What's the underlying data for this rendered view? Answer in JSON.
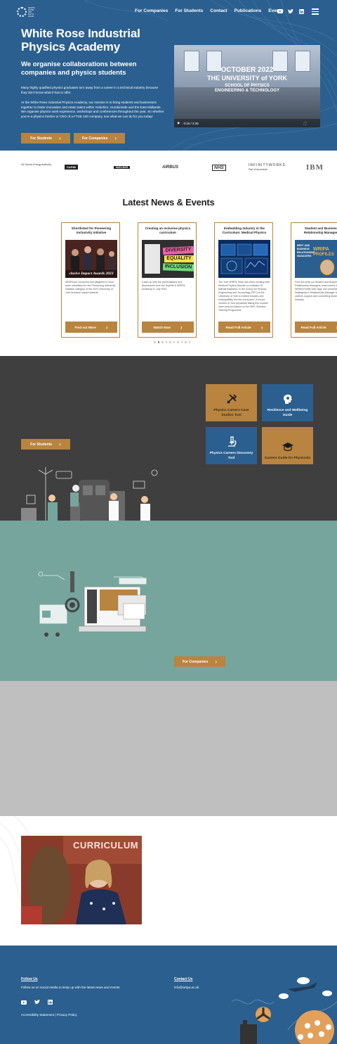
{
  "header": {
    "logo_alt": "White Rose Industrial Physics Academy",
    "nav": [
      "For Companies",
      "For Students",
      "Contact",
      "Publications",
      "Events"
    ],
    "social_icons": [
      "youtube-icon",
      "twitter-icon",
      "linkedin-icon"
    ]
  },
  "hero": {
    "title": "White Rose Industrial Physics Academy",
    "subtitle": "We organise collaborations between companies and physics students",
    "para1": "Many highly qualified physics graduates turn away from a career in a technical industry because they don't know what it has to offer.",
    "para2": "At the White Rose Industrial Physics Academy, our mission is to bring students and businesses together to foster innovation and retain talent within Yorkshire, Humberside and the East Midlands. We organise physics work experience, workshops and conferences throughout the year. So whether you're a physics fresher or CEO of a FTSE 100 company, see what we can do for you today!",
    "btn_students": "For Students",
    "btn_companies": "For Companies",
    "video": {
      "line1": "OCTOBER 2022",
      "line2": "THE UNIVERSITY of YORK",
      "line3": "SCHOOL OF PHYSICS",
      "line4": "ENGINEERING & TECHNOLOGY",
      "time": "0:15 / 2:46"
    }
  },
  "partners": [
    "UK Atomic Energy Authority",
    "CAPIM",
    "NUCLEAR",
    "AIRBUS",
    "NHS",
    "INFINITYWORKS",
    "Part of Accenture",
    "IBM"
  ],
  "news": {
    "title": "Latest News & Events",
    "cards": [
      {
        "title": "Shortlisted for Pioneering Inclusivity Initiative",
        "image_caption": "clusive Impact Awards 2023",
        "text": "WRIPA are honoured and delighted to have been shortlisted for the Pioneering Inclusivity Initiative category of the 2022 University of York Inclusive Impact Awards.",
        "button": "Find out More"
      },
      {
        "title": "Creating an inclusive physics curriculum",
        "image_words": [
          "DIVERSITY",
          "EQUALITY",
          "INCLUSION"
        ],
        "text": "Catch up with the presentations and discussions from the SepNet & WRIPA workshop in July 2022",
        "button": "Watch Now"
      },
      {
        "title": "Embedding Industry in the Curriculum: Medical Physics",
        "text": "The York WRIPA Team has been working with Medical Physics Module co-ordinator Dr Mikhail Bashkirov in the School for Physics Engineering and Technology (PET) at the University of York to embed industry and employability into the curriculum. A record number of York physicists taking this module have secured places on the NHS Scientist Training Programme.",
        "button": "Read Full Article"
      },
      {
        "title": "Student and Business Relationship Managers",
        "image_words": [
          "WRIPA",
          "PROFILES"
        ],
        "text": "Find out what our Student and Business Relationship Managers roles involve in this WRIPA Profile with Olga, the University of Nottingham's Relationship Manager for careers support and connecting students with industry.",
        "button": "Read Full Article"
      }
    ],
    "dots_count": 10,
    "active_dot": 1
  },
  "students_section": {
    "button": "For Students",
    "tiles": [
      {
        "label": "Physics Careers Case Studies Tool",
        "style": "gold"
      },
      {
        "label": "Resilience and Wellbeing Guide",
        "style": "blue"
      },
      {
        "label": "Physics Careers Discovery Tool",
        "style": "blue"
      },
      {
        "label": "Careers Guide for Physicists",
        "style": "gold"
      }
    ]
  },
  "companies_section": {
    "button": "For Companies"
  },
  "photo_section": {
    "banner_text": "CURRICULUM"
  },
  "footer": {
    "follow_heading": "Follow Us",
    "follow_text": "Follow us on social media to keep up with the latest news and events",
    "contact_heading": "Contact Us",
    "email": "info@wripa.ac.uk",
    "legal": "Accessibility Statement | Privacy Policy"
  },
  "colors": {
    "brand_blue": "#2b5f8f",
    "gold": "#b88440",
    "dark_gray": "#3f3f3f",
    "teal": "#76a59e"
  }
}
